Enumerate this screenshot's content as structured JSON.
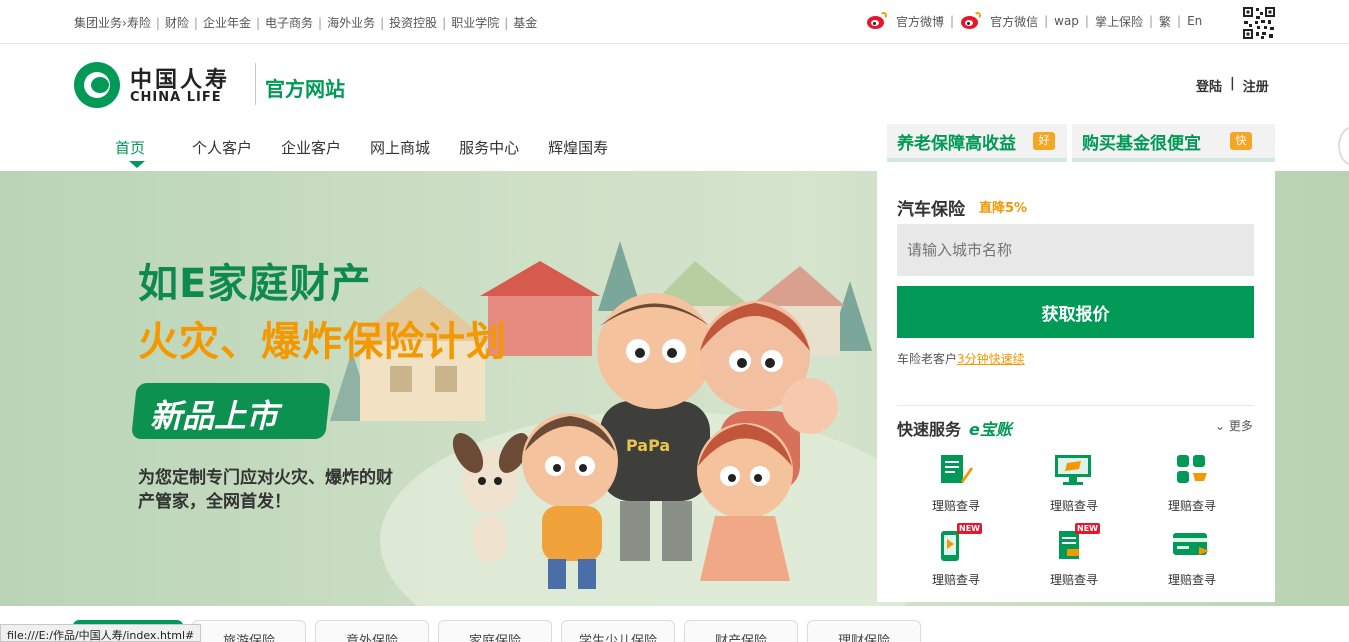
{
  "topbar": {
    "left_links": [
      "集团业务›",
      "寿险",
      "财险",
      "企业年金",
      "电子商务",
      "海外业务",
      "投资控股",
      "职业学院",
      "基金"
    ],
    "weibo": "官方微博",
    "weixin": "官方微信",
    "right_links": [
      "wap",
      "掌上保险",
      "繁",
      "En"
    ],
    "sep": "|"
  },
  "header": {
    "logo_cn": "中国人寿",
    "logo_en": "CHINA LIFE",
    "site_name": "官方网站",
    "login": "登陆",
    "register": "注册",
    "auth_sep": "|"
  },
  "nav": {
    "items": [
      "首页",
      "个人客户",
      "企业客户",
      "网上商城",
      "服务中心",
      "辉煌国寿"
    ]
  },
  "promos": [
    {
      "label": "养老保障高收益",
      "tag": "好"
    },
    {
      "label": "购买基金很便宜",
      "tag": "快"
    }
  ],
  "banner": {
    "headline1": "如E家庭财产",
    "headline2": "火灾、爆炸保险计划",
    "badge": "新品上市",
    "subtext": "为您定制专门应对火灾、爆炸的财产管家，全网首发！",
    "shirt_text": "PaPa"
  },
  "panel": {
    "car_title": "汽车保险",
    "car_tag": "直降5%",
    "city_placeholder": "请输入城市名称",
    "quote_button": "获取报价",
    "renew_prefix": "车险老客户",
    "renew_link": "3分钟快速续",
    "quick_title": "快速服务",
    "ebao": "e宝账",
    "more": "更多",
    "services": [
      {
        "label": "理赔查寻",
        "icon": "document-pen-icon"
      },
      {
        "label": "理赔查寻",
        "icon": "monitor-icon"
      },
      {
        "label": "理赔查寻",
        "icon": "grid-cart-icon"
      },
      {
        "label": "理赔查寻",
        "icon": "mobile-new-icon"
      },
      {
        "label": "理赔查寻",
        "icon": "document-new-icon"
      },
      {
        "label": "理赔查寻",
        "icon": "card-arrow-icon"
      }
    ],
    "new_flag": "NEW"
  },
  "bottom_tabs": [
    "",
    "旅游保险",
    "意外保险",
    "家庭保险",
    "学生少儿保险",
    "财产保险",
    "理财保险"
  ],
  "statusbar": "file:///E:/作品/中国人寿/index.html#",
  "colors": {
    "brand_green": "#009a56",
    "accent_orange": "#f39800"
  }
}
